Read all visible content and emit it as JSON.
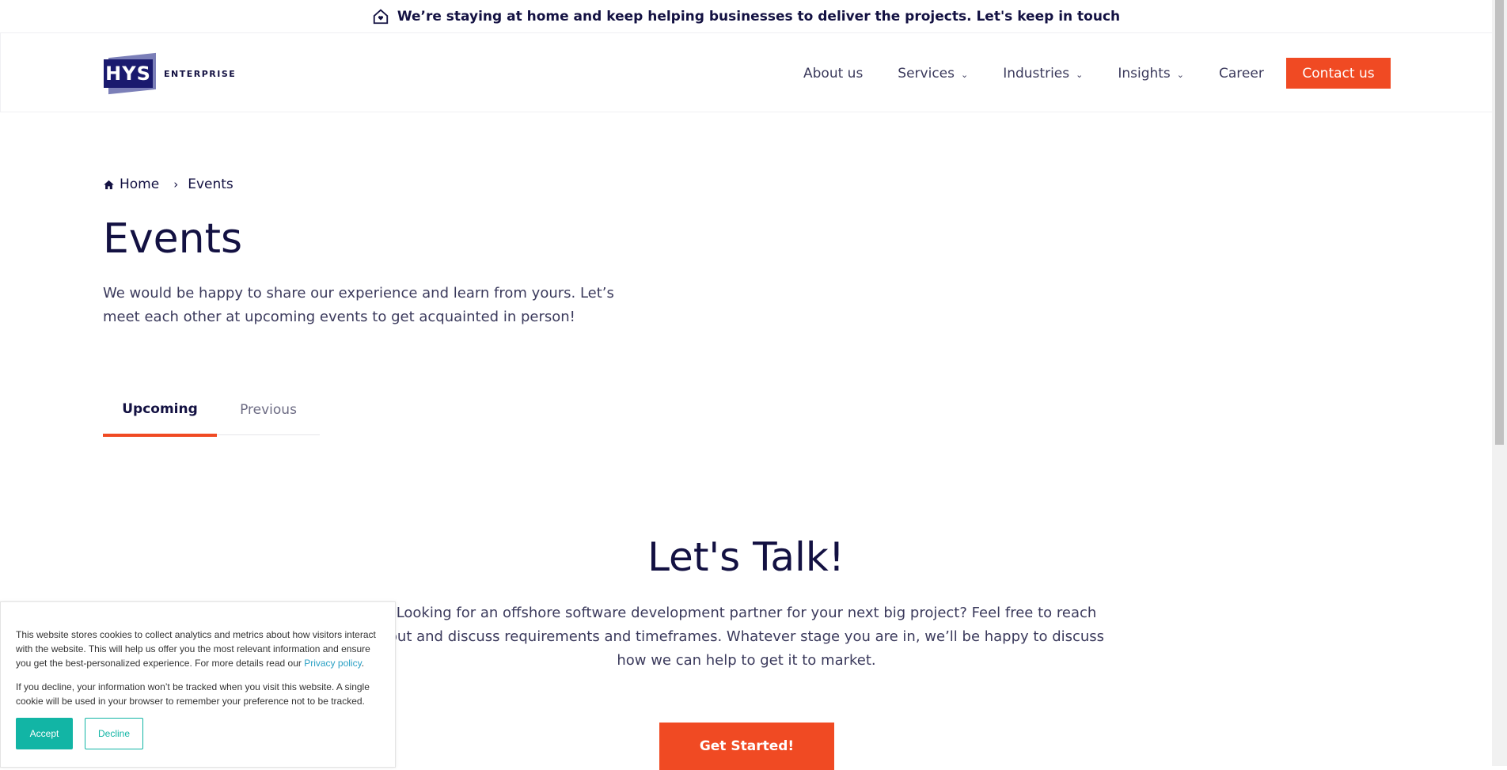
{
  "banner": {
    "text": "We’re staying at home and keep helping businesses to deliver the projects. Let's keep in touch"
  },
  "logo": {
    "mark": "HYS",
    "text": "ENTERPRISE"
  },
  "nav": {
    "items": [
      {
        "label": "About us"
      },
      {
        "label": "Services"
      },
      {
        "label": "Industries"
      },
      {
        "label": "Insights"
      },
      {
        "label": "Career"
      }
    ],
    "contact_label": "Contact us"
  },
  "breadcrumb": {
    "home": "Home",
    "current": "Events"
  },
  "page": {
    "title": "Events",
    "intro": "We would be happy to share our experience and learn from yours. Let’s meet each other at upcoming events to get acquainted in person!"
  },
  "tabs": [
    {
      "label": "Upcoming"
    },
    {
      "label": "Previous"
    }
  ],
  "talk": {
    "title": "Let's Talk!",
    "text": "Looking for an offshore software development partner for your next big project? Feel free to reach out and discuss requirements and timeframes. Whatever stage you are in, we’ll be happy to discuss how we can help to get it to market.",
    "button": "Get Started!"
  },
  "cookie": {
    "text1": "This website stores cookies to collect analytics and metrics about how visitors interact with the website. This will help us offer you the most relevant information and ensure you get the best-personalized experience. For more details read our",
    "link": "Privacy policy",
    "text2": "If you decline, your information won’t be tracked when you visit this website. A single cookie will be used in your browser to remember your preference not to be tracked.",
    "accept": "Accept",
    "decline": "Decline"
  },
  "colors": {
    "accent": "#f04a23",
    "navy": "#131142",
    "cookie_accent": "#12b5a5"
  }
}
